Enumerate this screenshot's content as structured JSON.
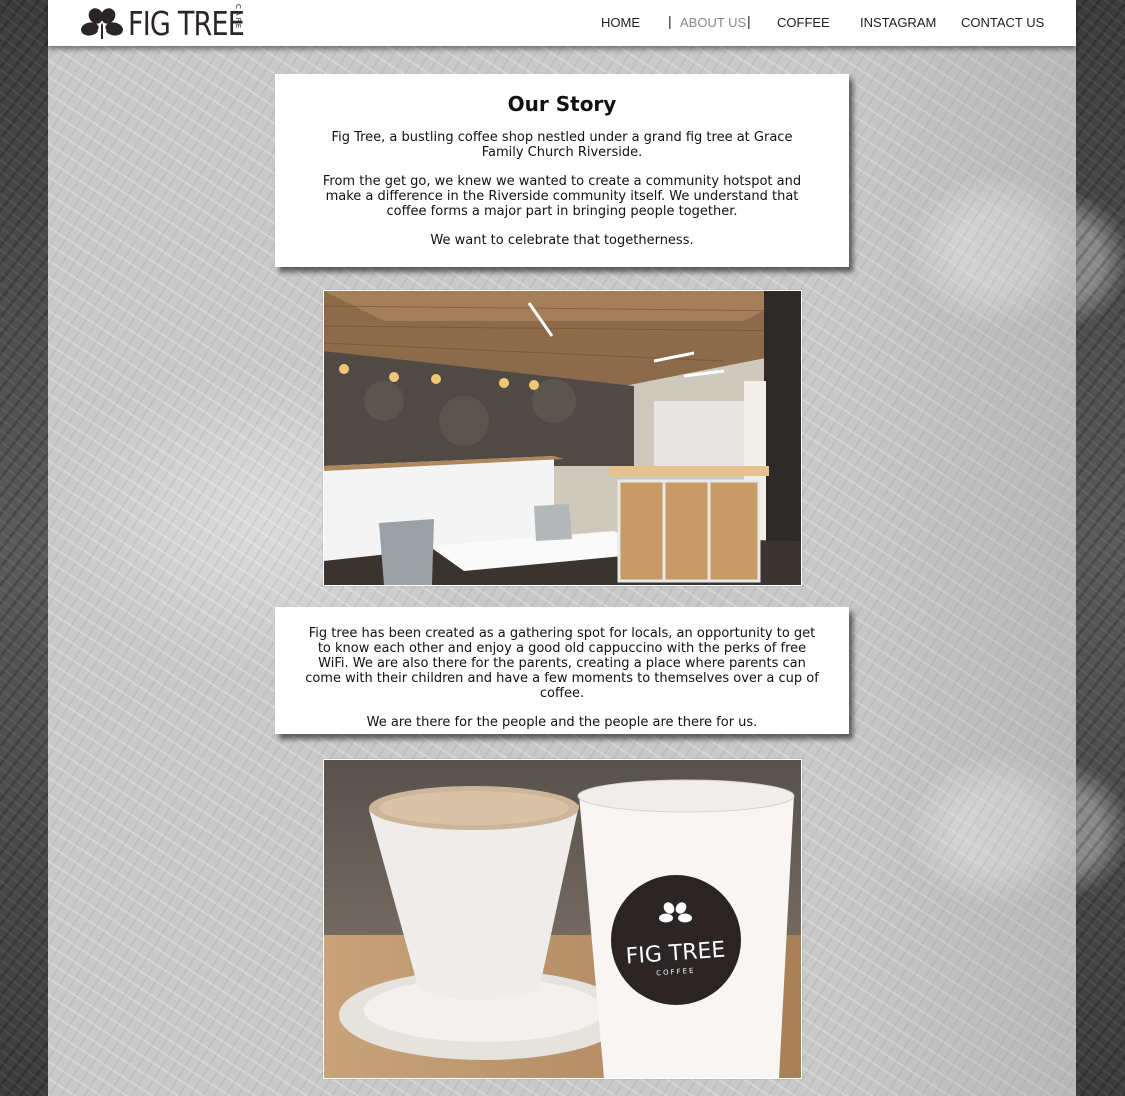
{
  "brand": {
    "name": "FIG TREE",
    "sub": "CAFE"
  },
  "nav": {
    "items": [
      {
        "label": "HOME"
      },
      {
        "label": "ABOUT US"
      },
      {
        "label": "COFFEE"
      },
      {
        "label": "INSTAGRAM"
      },
      {
        "label": "CONTACT US"
      }
    ],
    "separator": "|",
    "active": "ABOUT US"
  },
  "story": {
    "title": "Our Story",
    "paragraphs": [
      "Fig Tree, a bustling coffee shop nestled under a grand fig tree at Grace Family Church Riverside.",
      "From the get go, we knew we wanted to create a community hotspot and make a difference in the Riverside community itself. We understand that coffee forms a major part in bringing people together.",
      "We want to celebrate that togetherness."
    ]
  },
  "about": {
    "paragraphs": [
      "Fig tree has been created as a gathering spot for locals, an opportunity to get to know each other and enjoy a good old cappuccino with the perks of free WiFi. We are also there for the parents, creating a place where parents can come with their children and have a few moments to themselves over a cup of coffee.",
      "We are there for the people and the people are there for us."
    ]
  },
  "cup_logo": {
    "name": "FIG TREE",
    "sub": "COFFEE"
  },
  "colors": {
    "brand_dark": "#2b2525",
    "nav_active": "#8a8a8a"
  }
}
